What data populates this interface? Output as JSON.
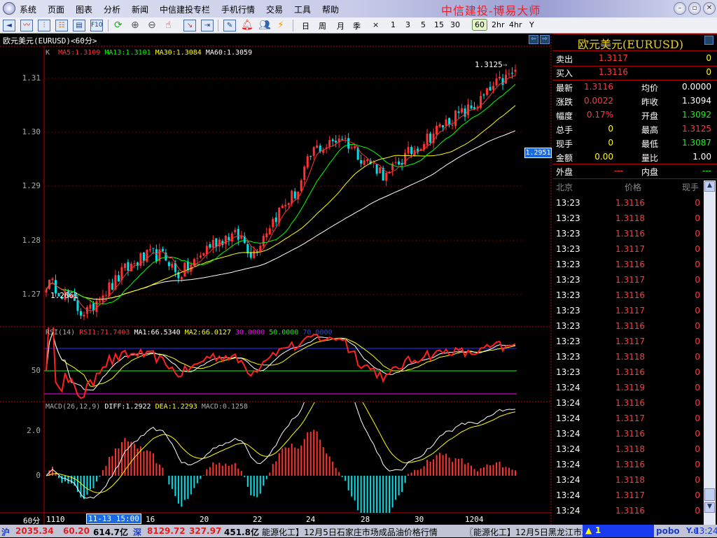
{
  "app": {
    "title": "中信建投-博易大师",
    "menu": [
      "系统",
      "页面",
      "图表",
      "分析",
      "新闻",
      "中信建投专栏",
      "手机行情",
      "交易",
      "工具",
      "帮助"
    ]
  },
  "toolbar": {
    "periods": [
      "日",
      "周",
      "月",
      "季",
      "×",
      "1",
      "3",
      "5",
      "15",
      "30",
      "60",
      "2hr",
      "4hr",
      "Y"
    ],
    "selected_period": "60"
  },
  "chart": {
    "title": "欧元美元(EURUSD)<60分>",
    "ma_legend": {
      "k": "K",
      "ma5": "MA5:1.3109",
      "ma13": "MA13:1.3101",
      "ma30": "MA30:1.3084",
      "ma60": "MA60:1.3059"
    },
    "price_axis": [
      "1.31",
      "1.30",
      "1.29",
      "1.28",
      "1.27"
    ],
    "high_label": "1.3125",
    "low_label": "1.2661",
    "cursor_price": "1.2951",
    "rsi_legend": {
      "name": "RSI(14)",
      "rsi1": "RSI1:71.7403",
      "ma1": "MA1:66.5340",
      "ma2": "MA2:66.0127",
      "l30": "30.0000",
      "l50": "50.0000",
      "l70": "70.0000"
    },
    "rsi_axis": "50",
    "macd_legend": {
      "name": "MACD(26,12,9)",
      "diff": "DIFF:1.2922",
      "dea": "DEA:1.2293",
      "macd": "MACD:0.1258"
    },
    "macd_axis": [
      "2.0",
      "0"
    ],
    "x_period": "60分",
    "x_labels": [
      "1110",
      "16",
      "20",
      "22",
      "24",
      "28",
      "30",
      "1204"
    ],
    "x_cursor": "11-13 15:00"
  },
  "chart_data": {
    "type": "candlestick",
    "symbol": "EURUSD",
    "interval": "60min",
    "bars": 150,
    "ylim": [
      1.265,
      1.316
    ],
    "price_waypoints": [
      [
        0,
        1.272
      ],
      [
        4,
        1.2715
      ],
      [
        8,
        1.2695
      ],
      [
        13,
        1.267
      ],
      [
        17,
        1.2668
      ],
      [
        20,
        1.27
      ],
      [
        25,
        1.2715
      ],
      [
        30,
        1.2745
      ],
      [
        36,
        1.2765
      ],
      [
        42,
        1.2775
      ],
      [
        47,
        1.2765
      ],
      [
        50,
        1.2735
      ],
      [
        53,
        1.2745
      ],
      [
        58,
        1.2765
      ],
      [
        62,
        1.279
      ],
      [
        70,
        1.281
      ],
      [
        75,
        1.2805
      ],
      [
        79,
        1.2775
      ],
      [
        81,
        1.279
      ],
      [
        85,
        1.2825
      ],
      [
        91,
        1.2865
      ],
      [
        97,
        1.2895
      ],
      [
        100,
        1.294
      ],
      [
        103,
        1.297
      ],
      [
        108,
        1.2975
      ],
      [
        113,
        1.2995
      ],
      [
        117,
        1.2975
      ],
      [
        122,
        1.295
      ],
      [
        127,
        1.2935
      ],
      [
        131,
        1.2915
      ],
      [
        134,
        1.294
      ],
      [
        139,
        1.296
      ],
      [
        145,
        1.2985
      ],
      [
        150,
        1.3005
      ],
      [
        155,
        1.3025
      ],
      [
        160,
        1.3035
      ],
      [
        166,
        1.3055
      ],
      [
        172,
        1.3085
      ],
      [
        178,
        1.3105
      ],
      [
        180,
        1.3116
      ]
    ]
  },
  "quote": {
    "title": "欧元美元(EURUSD)",
    "sell": {
      "label": "卖出",
      "price": "1.3117",
      "vol": "0"
    },
    "buy": {
      "label": "买入",
      "price": "1.3116",
      "vol": "0"
    },
    "rows": [
      {
        "l1": "最新",
        "v1": "1.3116",
        "l2": "均价",
        "v2": "0.0000",
        "c1": "#ff3b3b",
        "c2": "#fff"
      },
      {
        "l1": "涨跌",
        "v1": "0.0022",
        "l2": "昨收",
        "v2": "1.3094",
        "c1": "#ff3b3b",
        "c2": "#fff"
      },
      {
        "l1": "幅度",
        "v1": "0.17%",
        "l2": "开盘",
        "v2": "1.3092",
        "c1": "#ff3b3b",
        "c2": "#22ee22"
      },
      {
        "l1": "总手",
        "v1": "0",
        "l2": "最高",
        "v2": "1.3125",
        "c1": "#ffff00",
        "c2": "#ff3b3b"
      },
      {
        "l1": "现手",
        "v1": "0",
        "l2": "最低",
        "v2": "1.3087",
        "c1": "#ffff00",
        "c2": "#22ee22"
      },
      {
        "l1": "金额",
        "v1": "0.00",
        "l2": "量比",
        "v2": "1.00",
        "c1": "#ffff00",
        "c2": "#fff"
      }
    ],
    "outer": {
      "label": "外盘",
      "value": "---"
    },
    "inner": {
      "label": "内盘",
      "value": "---"
    },
    "tick_headers": [
      "北京",
      "价格",
      "现手"
    ],
    "ticks": [
      [
        "13:23",
        "1.3116",
        "0"
      ],
      [
        "13:23",
        "1.3118",
        "0"
      ],
      [
        "13:23",
        "1.3116",
        "0"
      ],
      [
        "13:23",
        "1.3117",
        "0"
      ],
      [
        "13:23",
        "1.3116",
        "0"
      ],
      [
        "13:23",
        "1.3117",
        "0"
      ],
      [
        "13:23",
        "1.3116",
        "0"
      ],
      [
        "13:23",
        "1.3117",
        "0"
      ],
      [
        "13:23",
        "1.3116",
        "0"
      ],
      [
        "13:23",
        "1.3117",
        "0"
      ],
      [
        "13:23",
        "1.3118",
        "0"
      ],
      [
        "13:23",
        "1.3116",
        "0"
      ],
      [
        "13:24",
        "1.3119",
        "0"
      ],
      [
        "13:24",
        "1.3116",
        "0"
      ],
      [
        "13:24",
        "1.3117",
        "0"
      ],
      [
        "13:24",
        "1.3116",
        "0"
      ],
      [
        "13:24",
        "1.3118",
        "0"
      ],
      [
        "13:24",
        "1.3116",
        "0"
      ],
      [
        "13:24",
        "1.3118",
        "0"
      ],
      [
        "13:24",
        "1.3117",
        "0"
      ],
      [
        "13:24",
        "1.3116",
        "0"
      ]
    ]
  },
  "status": {
    "sh_label": "沪",
    "sh_index": "2035.34",
    "sh_change": "60.20",
    "sh_amount": "614.7亿",
    "sz_label": "深",
    "sz_index": "8129.72",
    "sz_change": "327.97",
    "sz_amount": "451.8亿",
    "news1": "能源化工】12月5日石家庄市场成品油价格行情",
    "news2": "〖能源化工】12月5日黑龙江市场成",
    "alert": "1",
    "brand": "pobo",
    "time": "13:24"
  },
  "colors": {
    "up": "#ff3232",
    "down": "#00e0e8",
    "ma5": "#ff3232",
    "ma13": "#00ff00",
    "ma30": "#ffff00",
    "ma60": "#ffffff"
  }
}
